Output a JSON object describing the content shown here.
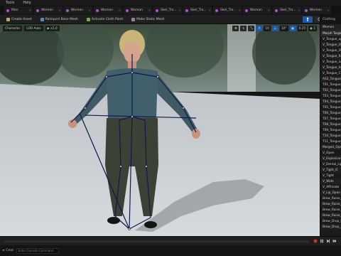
{
  "menubar": {
    "items": [
      "Tools",
      "Help"
    ]
  },
  "tabs": [
    {
      "label": "Man"
    },
    {
      "label": "Woman"
    },
    {
      "label": "Woman"
    },
    {
      "label": "Woman"
    },
    {
      "label": "Woman"
    },
    {
      "label": "Skel_Tra..."
    },
    {
      "label": "Skel_Tra..."
    },
    {
      "label": "Skel_Tra..."
    },
    {
      "label": "Woman"
    },
    {
      "label": "Skel_Tra..."
    },
    {
      "label": "Woman"
    },
    {
      "label": "Woman"
    }
  ],
  "toolbar": {
    "buttons": [
      {
        "label": "Create Asset",
        "icon": "wrench-icon",
        "color": "#c9a94a"
      },
      {
        "label": "Reimport Base Mesh",
        "icon": "reimport-icon",
        "color": "#4a8cd6"
      },
      {
        "label": "Activate Cloth Paint",
        "icon": "paint-icon",
        "color": "#7aa84a"
      },
      {
        "label": "Make Static Mesh",
        "icon": "static-mesh-icon",
        "color": "#8a8a8a"
      }
    ]
  },
  "viewport": {
    "view_mode": "Character",
    "lod": "LOD Auto",
    "playback": "x1.0",
    "grid_snap": "10",
    "rot_snap": "10°",
    "scale_snap": "0.25",
    "cam_speed": "1"
  },
  "panel": {
    "tab_label": "Clothing",
    "subheader": "Woman",
    "search_placeholder": "Morph Target",
    "items": [
      "Morph Target",
      "V_Tongue_up",
      "V_Tongue_Ou...",
      "V_Tongue_Ou...",
      "V_Tongue_Ra...",
      "V_Tongue_Lo...",
      "V_Tongue_In...",
      "V_Tongue_Cu...",
      "AS3_Tongue_...",
      "T01_Tongue_...",
      "T02_Tongue_...",
      "T03_Tongue_...",
      "T04_Tongue_...",
      "T05_Tongue_...",
      "T06_Tongue_...",
      "T07_Tongue_...",
      "T08_Tongue_...",
      "T09_Tongue_...",
      "T10_Tongue_...",
      "T11_Tongue_...",
      "Merged_Open...",
      "V_Open",
      "V_Explosive",
      "V_Dental_Lip",
      "V_Tight_O",
      "V_Tight",
      "V_Wide",
      "V_Affricate",
      "V_Lip_Open",
      "Brow_Raise_I...",
      "Brow_Raise_I...",
      "Brow_Raise_...",
      "Brow_Raise_...",
      "Brow_Drop_L...",
      "Brow_Drop_..."
    ]
  },
  "statusbar": {
    "cmd_label": "Cmd",
    "cmd_placeholder": "Enter Console Command"
  }
}
